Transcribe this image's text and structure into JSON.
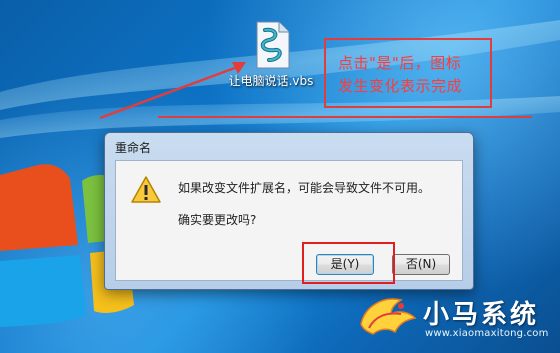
{
  "desktop": {
    "icon_label": "让电脑说话.vbs",
    "icon_name": "script-file-icon"
  },
  "annotation": {
    "line1": "点击\"是\"后，图标",
    "line2": "发生变化表示完成",
    "color": "#e23d3d"
  },
  "dialog": {
    "title": "重命名",
    "message": "如果改变文件扩展名，可能会导致文件不可用。",
    "question": "确实要更改吗?",
    "yes_label": "是(Y)",
    "no_label": "否(N)"
  },
  "logo": {
    "title": "小马系统",
    "url": "www.xiaomaxitong.com"
  }
}
